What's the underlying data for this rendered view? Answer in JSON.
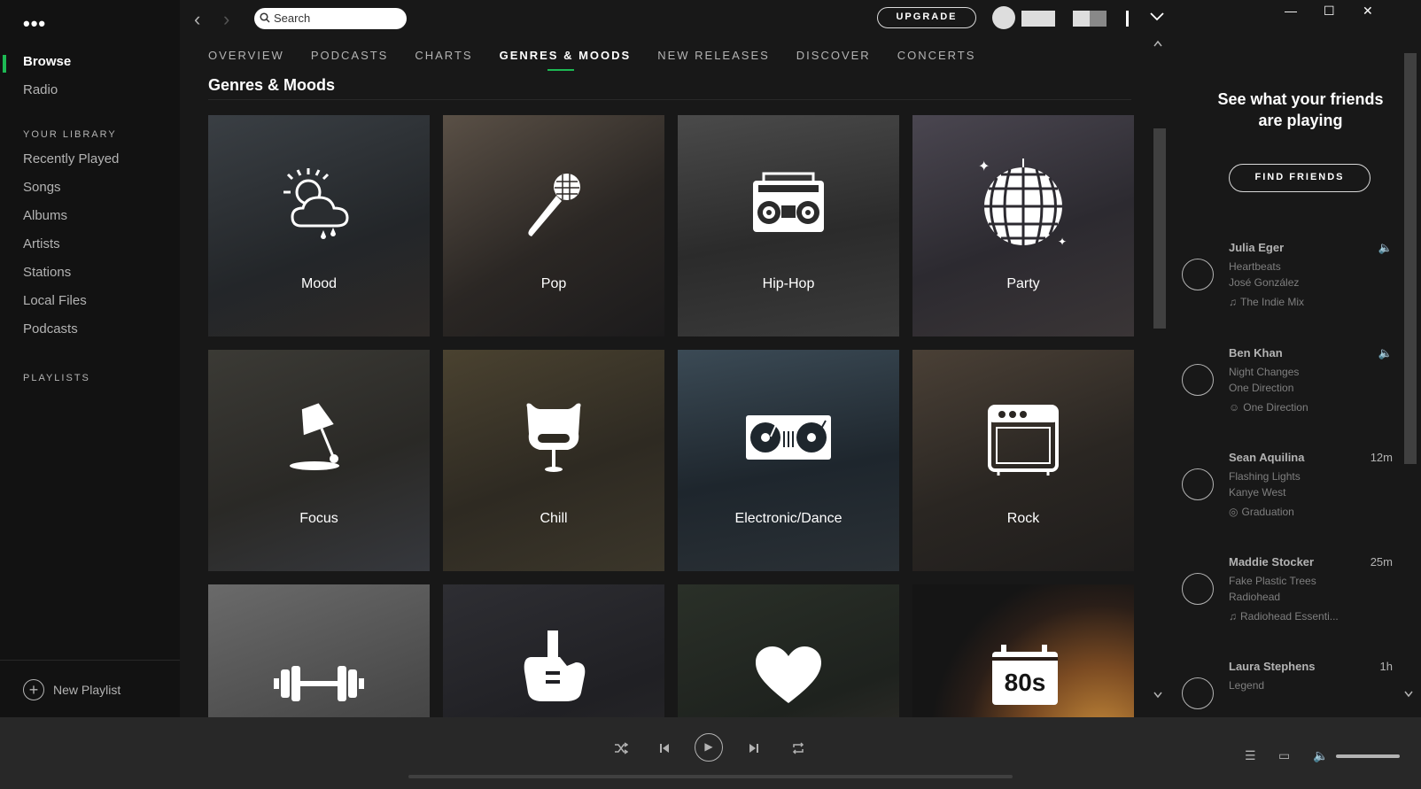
{
  "sidebar": {
    "menu_dots": "•••",
    "browse": "Browse",
    "radio": "Radio",
    "your_library_label": "YOUR LIBRARY",
    "library": [
      "Recently Played",
      "Songs",
      "Albums",
      "Artists",
      "Stations",
      "Local Files",
      "Podcasts"
    ],
    "playlists_label": "PLAYLISTS",
    "new_playlist": "New Playlist"
  },
  "topbar": {
    "search_placeholder": "Search",
    "upgrade": "UPGRADE"
  },
  "tabs": [
    "OVERVIEW",
    "PODCASTS",
    "CHARTS",
    "GENRES & MOODS",
    "NEW RELEASES",
    "DISCOVER",
    "CONCERTS"
  ],
  "active_tab": "GENRES & MOODS",
  "page_title": "Genres & Moods",
  "tiles": [
    {
      "label": "Mood",
      "icon": "weather-icon"
    },
    {
      "label": "Pop",
      "icon": "microphone-icon"
    },
    {
      "label": "Hip-Hop",
      "icon": "boombox-icon"
    },
    {
      "label": "Party",
      "icon": "disco-ball-icon"
    },
    {
      "label": "Focus",
      "icon": "desk-lamp-icon"
    },
    {
      "label": "Chill",
      "icon": "egg-chair-icon"
    },
    {
      "label": "Electronic/Dance",
      "icon": "turntables-icon"
    },
    {
      "label": "Rock",
      "icon": "amplifier-icon"
    },
    {
      "label": "",
      "icon": "dumbbell-icon"
    },
    {
      "label": "",
      "icon": "guitar-icon"
    },
    {
      "label": "",
      "icon": "heart-icon"
    },
    {
      "label": "",
      "icon": "80s-calendar-icon",
      "icon_text": "80s"
    }
  ],
  "friends": {
    "heading": "See what your friends are playing",
    "find_friends": "FIND FRIENDS",
    "list": [
      {
        "name": "Julia Eger",
        "time": "",
        "track": "Heartbeats",
        "artist": "José González",
        "context": "The Indie Mix",
        "context_icon": "music-note-icon"
      },
      {
        "name": "Ben Khan",
        "time": "",
        "track": "Night Changes",
        "artist": "One Direction",
        "context": "One Direction",
        "context_icon": "artist-icon"
      },
      {
        "name": "Sean Aquilina",
        "time": "12m",
        "track": "Flashing Lights",
        "artist": "Kanye West",
        "context": "Graduation",
        "context_icon": "album-icon"
      },
      {
        "name": "Maddie Stocker",
        "time": "25m",
        "track": "Fake Plastic Trees",
        "artist": "Radiohead",
        "context": "Radiohead Essenti...",
        "context_icon": "music-note-icon"
      },
      {
        "name": "Laura Stephens",
        "time": "1h",
        "track": "Legend",
        "artist": "",
        "context": "",
        "context_icon": ""
      }
    ]
  },
  "window_controls": {
    "minimize": "—",
    "maximize": "☐",
    "close": "✕"
  },
  "player": {
    "shuffle": "shuffle-icon",
    "prev": "previous-icon",
    "play": "play-icon",
    "next": "next-icon",
    "repeat": "repeat-icon"
  },
  "colors": {
    "accent": "#1db954",
    "bg": "#121212",
    "main": "#181818"
  }
}
